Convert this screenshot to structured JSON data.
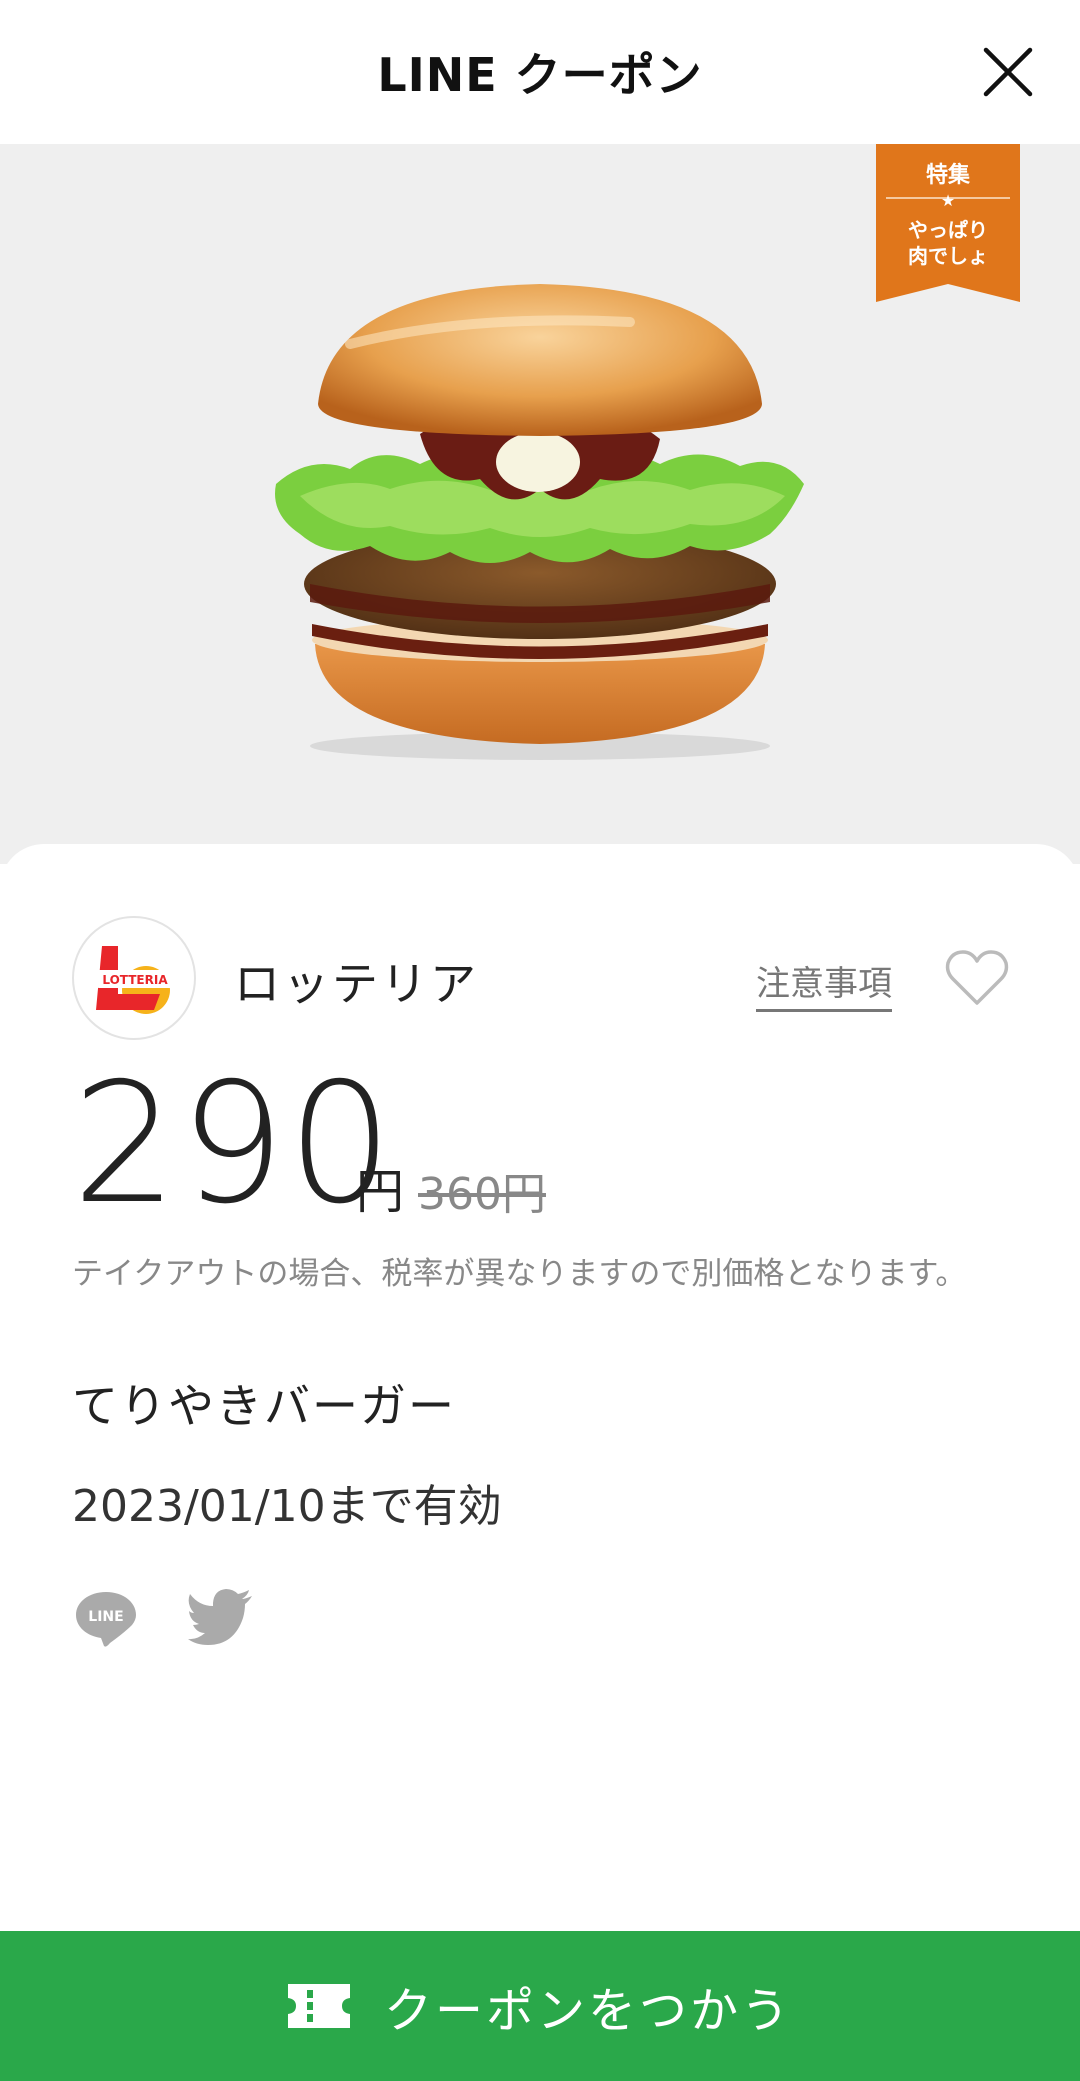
{
  "header": {
    "title": "LINE クーポン",
    "close_icon": "close-icon"
  },
  "hero": {
    "image": "teriyaki-burger-photo",
    "ribbon": {
      "line1": "特集",
      "line2": "やっぱり",
      "line3": "肉でしょ",
      "color": "#e0761b"
    }
  },
  "shop": {
    "logo_text": "LOTTERIA",
    "name": "ロッテリア",
    "notes_label": "注意事項",
    "favorite_icon": "heart-outline-icon"
  },
  "offer": {
    "price": "290",
    "yen": "円",
    "original_price": "360円",
    "tax_note": "テイクアウトの場合、税率が異なりますので別価格となります。",
    "item_name": "てりやきバーガー",
    "valid_until": "2023/01/10まで有効"
  },
  "share": {
    "line_icon": "line-share-icon",
    "line_icon_text": "LINE",
    "twitter_icon": "twitter-share-icon"
  },
  "cta": {
    "label": "クーポンをつかう",
    "icon": "ticket-icon",
    "color": "#2aa84a"
  }
}
